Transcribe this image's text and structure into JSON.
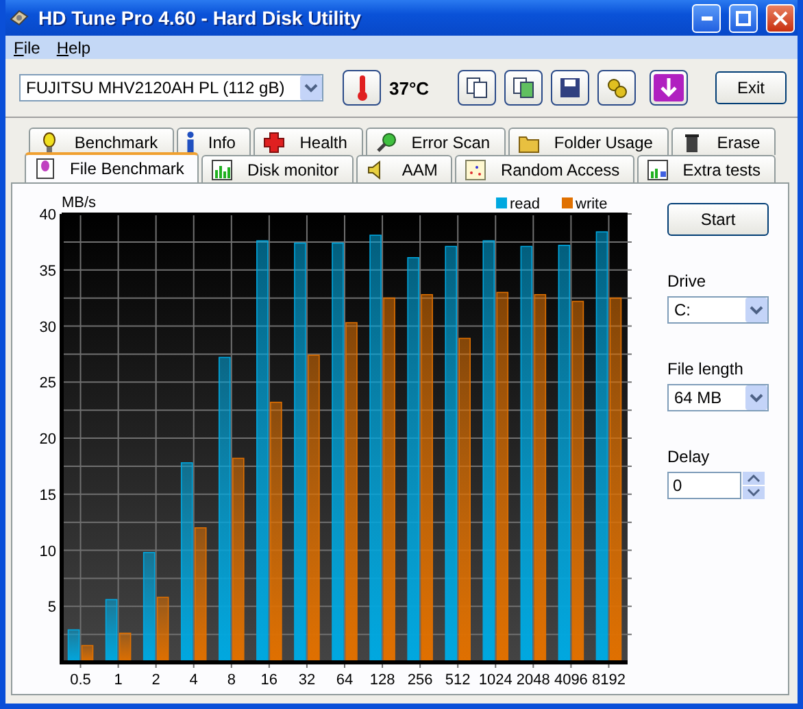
{
  "window": {
    "title": "HD Tune Pro 4.60 - Hard Disk Utility"
  },
  "menu": [
    {
      "label": "File"
    },
    {
      "label": "Help"
    }
  ],
  "toolbar": {
    "drive": "FUJITSU MHV2120AH PL (112 gB)",
    "temperature": "37°C",
    "exit": "Exit"
  },
  "tab_rows": [
    [
      {
        "label": "Benchmark",
        "selected": false
      },
      {
        "label": "Info",
        "selected": false
      },
      {
        "label": "Health",
        "selected": false
      },
      {
        "label": "Error Scan",
        "selected": false
      },
      {
        "label": "Folder Usage",
        "selected": false
      },
      {
        "label": "Erase",
        "selected": false
      }
    ],
    [
      {
        "label": "File Benchmark",
        "selected": true
      },
      {
        "label": "Disk monitor",
        "selected": false
      },
      {
        "label": "AAM",
        "selected": false
      },
      {
        "label": "Random Access",
        "selected": false
      },
      {
        "label": "Extra tests",
        "selected": false
      }
    ]
  ],
  "benchmark": {
    "chart_data": {
      "type": "bar",
      "ylabel": "MB/s",
      "categories": [
        "0.5",
        "1",
        "2",
        "4",
        "8",
        "16",
        "32",
        "64",
        "128",
        "256",
        "512",
        "1024",
        "2048",
        "4096",
        "8192"
      ],
      "series": [
        {
          "name": "read",
          "color": "#00a8e0",
          "values": [
            2.9,
            5.6,
            9.8,
            17.8,
            27.2,
            37.6,
            37.4,
            37.4,
            38.1,
            36.1,
            37.1,
            37.6,
            37.1,
            37.2,
            38.4
          ]
        },
        {
          "name": "write",
          "color": "#e07000",
          "values": [
            1.5,
            2.6,
            5.8,
            12.0,
            18.2,
            23.2,
            27.4,
            30.3,
            32.5,
            32.8,
            28.9,
            33.0,
            32.8,
            32.2,
            32.5
          ]
        }
      ],
      "ylim": [
        0,
        40
      ],
      "yticks": [
        5,
        10,
        15,
        20,
        25,
        30,
        35,
        40
      ],
      "grid": true,
      "legend": true
    },
    "start": "Start",
    "fields": [
      {
        "kind": "dropdown",
        "label": "Drive",
        "value": "C:"
      },
      {
        "kind": "dropdown",
        "label": "File length",
        "value": "64 MB"
      },
      {
        "kind": "spinner",
        "label": "Delay",
        "value": "0"
      }
    ]
  }
}
